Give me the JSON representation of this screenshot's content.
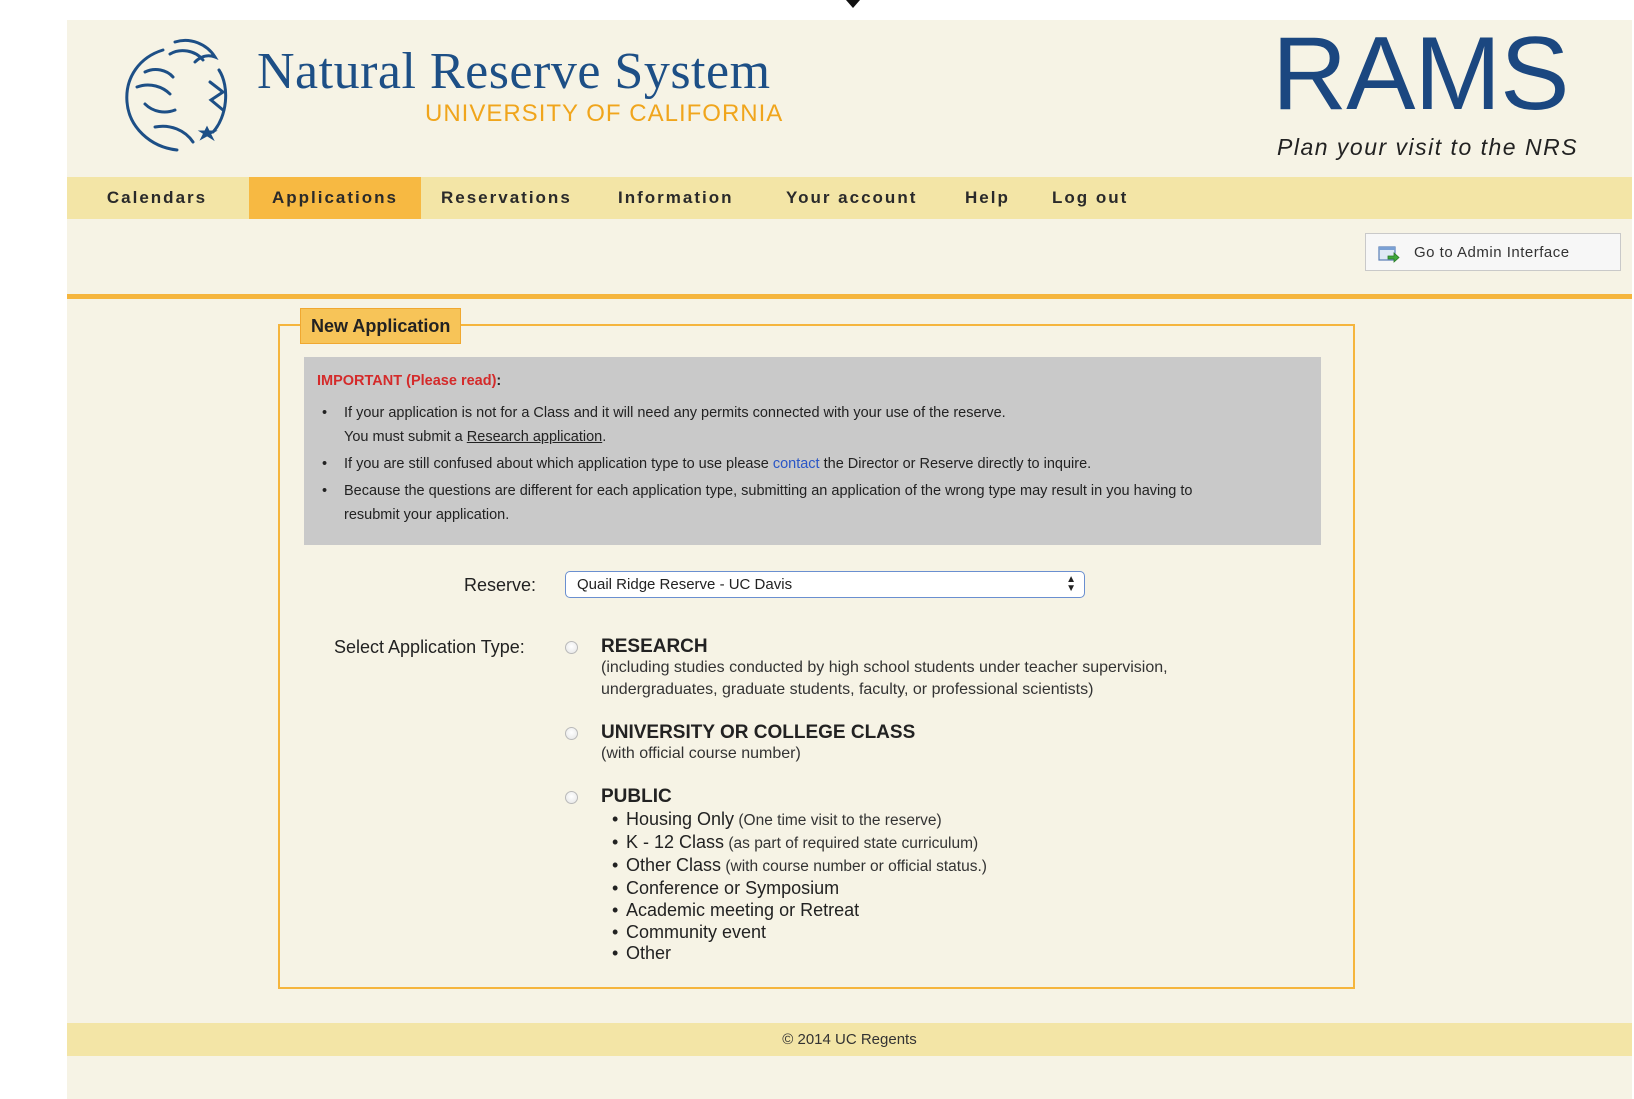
{
  "header": {
    "brand_title": "Natural Reserve System",
    "brand_subtitle": "UNIVERSITY OF CALIFORNIA",
    "app_title": "RAMS",
    "app_tagline": "Plan your visit to the NRS",
    "logo_icon": "nrs-logo-icon"
  },
  "nav": {
    "items": [
      {
        "label": "Calendars",
        "active": false
      },
      {
        "label": "Applications",
        "active": true
      },
      {
        "label": "Reservations",
        "active": false
      },
      {
        "label": "Information",
        "active": false
      },
      {
        "label": "Your account",
        "active": false
      },
      {
        "label": "Help",
        "active": false
      },
      {
        "label": "Log out",
        "active": false
      }
    ]
  },
  "admin_button": {
    "label": "Go to Admin Interface",
    "icon": "admin-go-icon"
  },
  "form": {
    "legend": "New Application",
    "notice": {
      "title": "IMPORTANT (Please read)",
      "title_suffix": ":",
      "item1_line1": "If your application is not for a Class and it will need any permits connected with your use of the reserve.",
      "item1_line2_pre": "You must submit a ",
      "item1_line2_link": "Research application",
      "item1_line2_post": ".",
      "item2_pre": "If you are still confused about which application type to use please ",
      "item2_link": "contact",
      "item2_post": " the Director or Reserve directly to inquire.",
      "item3_line1": "Because the questions are different for each application type, submitting an application of the wrong type may result in you having to",
      "item3_line2": "resubmit your application."
    },
    "reserve_label": "Reserve:",
    "reserve_value": "Quail Ridge Reserve - UC Davis",
    "app_type_label": "Select Application Type:",
    "options": {
      "research_title": "RESEARCH",
      "research_desc1": "(including studies conducted by high school students under teacher supervision,",
      "research_desc2": "undergraduates, graduate students, faculty, or professional scientists)",
      "class_title": "UNIVERSITY OR COLLEGE CLASS",
      "class_desc": "(with official course number)",
      "public_title": "PUBLIC",
      "public_items": [
        {
          "label": "Housing Only",
          "note": " (One time visit to the reserve)"
        },
        {
          "label": "K - 12 Class",
          "note": " (as part of required state curriculum)"
        },
        {
          "label": "Other Class",
          "note": " (with course number or official status.)"
        },
        {
          "label": "Conference or Symposium",
          "note": ""
        },
        {
          "label": "Academic meeting or Retreat",
          "note": ""
        },
        {
          "label": "Community event",
          "note": ""
        },
        {
          "label": "Other",
          "note": ""
        }
      ]
    }
  },
  "footer": {
    "text": "© 2014 UC Regents"
  },
  "colors": {
    "accent": "#f5b53d",
    "nav_bg": "#f3e5a6",
    "nav_active": "#f7b942",
    "brand_blue": "#1d4f86",
    "brand_gold": "#f0a51c",
    "page_bg": "#f6f3e5"
  }
}
